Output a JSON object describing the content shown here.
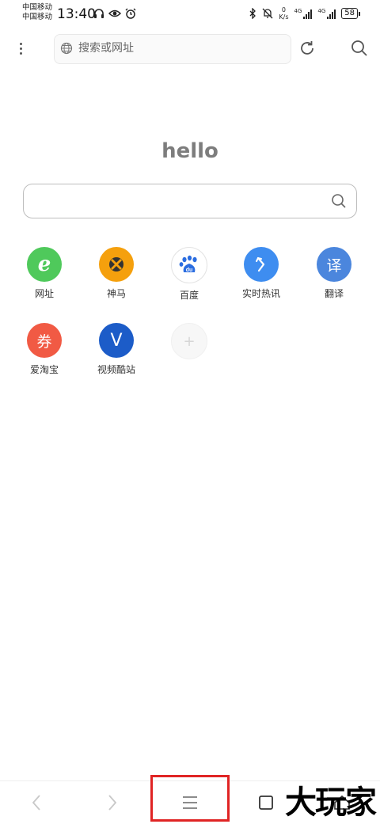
{
  "status_bar": {
    "carrier_1": "中国移动",
    "carrier_2": "中国移动",
    "time": "13:40",
    "net_speed_value": "0",
    "net_speed_unit": "K/s",
    "network_1": "4G",
    "network_2": "4G",
    "battery": "58"
  },
  "toolbar": {
    "address_placeholder": "搜索或网址"
  },
  "home": {
    "greeting": "hello",
    "search_value": ""
  },
  "shortcuts": [
    {
      "label": "网址",
      "icon": "e-logo-icon",
      "color": "#4fc95b",
      "glyph": "e"
    },
    {
      "label": "神马",
      "icon": "shenma-icon",
      "color": "#f5a00d",
      "glyph": ""
    },
    {
      "label": "百度",
      "icon": "baidu-paw-icon",
      "color": "#ffffff",
      "glyph": "du"
    },
    {
      "label": "实时热讯",
      "icon": "arrow-up-icon",
      "color": "#3e8df0",
      "glyph": ""
    },
    {
      "label": "翻译",
      "icon": "translate-icon",
      "color": "#4b86dd",
      "glyph": "译"
    },
    {
      "label": "爱淘宝",
      "icon": "coupon-icon",
      "color": "#f15a44",
      "glyph": "券"
    },
    {
      "label": "视频酷站",
      "icon": "v-logo-icon",
      "color": "#1c5cc8",
      "glyph": "V"
    },
    {
      "label": "",
      "icon": "plus-icon",
      "color": "#f7f7f7",
      "glyph": "+"
    }
  ],
  "watermark": "大玩家"
}
